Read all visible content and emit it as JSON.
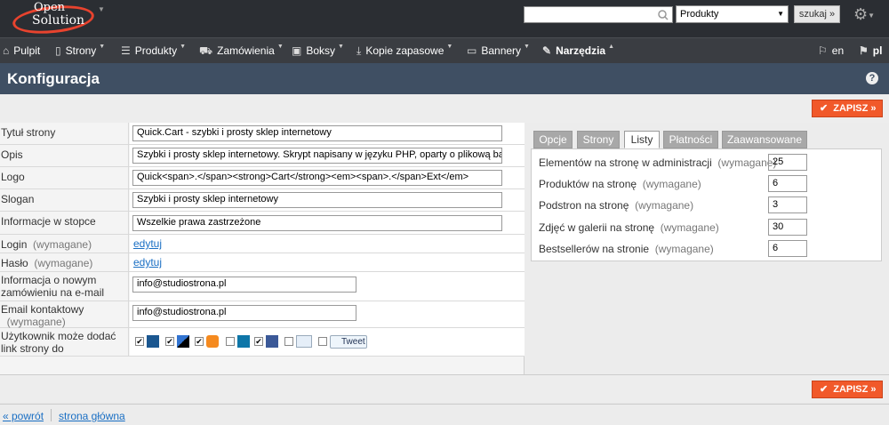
{
  "header": {
    "logo_line1": "Open",
    "logo_line2": "Solution",
    "search_value": "",
    "search_scope": "Produkty",
    "search_button": "szukaj »"
  },
  "nav": {
    "items": [
      {
        "label": "Pulpit",
        "icon": "home-icon"
      },
      {
        "label": "Strony",
        "icon": "page-icon"
      },
      {
        "label": "Produkty",
        "icon": "list-icon"
      },
      {
        "label": "Zamówienia",
        "icon": "cart-icon"
      },
      {
        "label": "Boksy",
        "icon": "box-icon"
      },
      {
        "label": "Kopie zapasowe",
        "icon": "download-icon"
      },
      {
        "label": "Bannery",
        "icon": "banner-icon"
      },
      {
        "label": "Narzędzia",
        "icon": "tools-icon"
      }
    ],
    "lang_en": "en",
    "lang_pl": "pl"
  },
  "page": {
    "title": "Konfiguracja",
    "save_label": "ZAPISZ »"
  },
  "form": {
    "title_label": "Tytuł strony",
    "title_value": "Quick.Cart - szybki i prosty sklep internetowy",
    "desc_label": "Opis",
    "desc_value": "Szybki i prosty sklep internetowy. Skrypt napisany w języku PHP, oparty o plikową bazę",
    "logo_label": "Logo",
    "logo_value": "Quick<span>.</span><strong>Cart</strong><em><span>.</span>Ext</em>",
    "slogan_label": "Slogan",
    "slogan_value": "Szybki i prosty sklep internetowy",
    "footer_label": "Informacje w stopce",
    "footer_value": "Wszelkie prawa zastrzeżone",
    "login_label": "Login",
    "login_req": "(wymagane)",
    "login_link": "edytuj",
    "pass_label": "Hasło",
    "pass_req": "(wymagane)",
    "pass_link": "edytuj",
    "order_label": "Informacja o nowym zamówieniu na e-mail",
    "order_value": "info@studiostrona.pl",
    "contact_label": "Email kontaktowy",
    "contact_req": "(wymagane)",
    "contact_value": "info@studiostrona.pl",
    "share_label": "Użytkownik może dodać link strony do",
    "tweet_label": "Tweet"
  },
  "tabs": [
    "Opcje",
    "Strony",
    "Listy",
    "Płatności",
    "Zaawansowane"
  ],
  "lists": {
    "req": "(wymagane)",
    "rows": [
      {
        "label": "Elementów na stronę w administracji",
        "value": "25"
      },
      {
        "label": "Produktów na stronę",
        "value": "6"
      },
      {
        "label": "Podstron na stronę",
        "value": "3"
      },
      {
        "label": "Zdjęć w galerii na stronę",
        "value": "30"
      },
      {
        "label": "Bestsellerów na stronie",
        "value": "6"
      }
    ]
  },
  "footer": {
    "back": "« powrót",
    "home": "strona główna"
  }
}
